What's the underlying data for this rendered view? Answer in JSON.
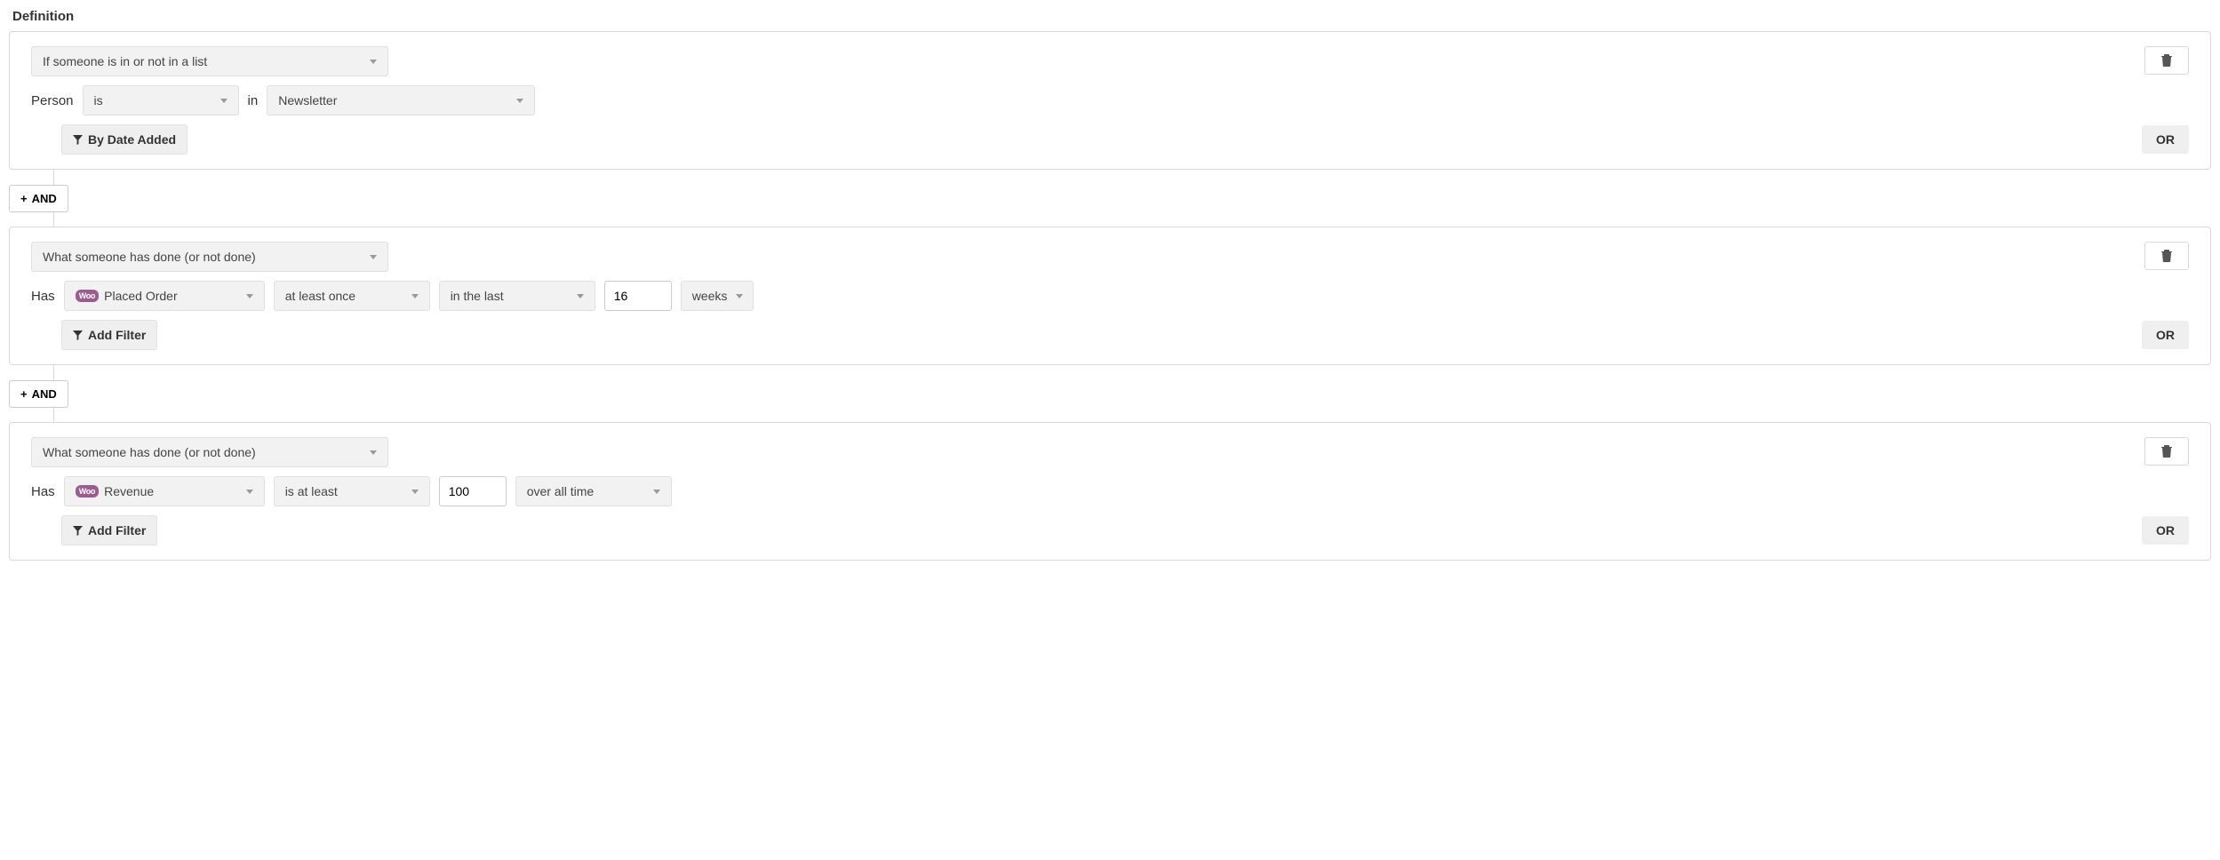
{
  "sectionTitle": "Definition",
  "common": {
    "orLabel": "OR",
    "andLabel": "AND",
    "wooBadge": "Woo"
  },
  "rule1": {
    "condition": "If someone is in or not in a list",
    "personLabel": "Person",
    "personOp": "is",
    "inLabel": "in",
    "listName": "Newsletter",
    "dateAddedBtn": "By Date Added"
  },
  "rule2": {
    "condition": "What someone has done (or not done)",
    "hasLabel": "Has",
    "metric": "Placed Order",
    "frequency": "at least once",
    "timeframe": "in the last",
    "count": "16",
    "unit": "weeks",
    "addFilterBtn": "Add Filter"
  },
  "rule3": {
    "condition": "What someone has done (or not done)",
    "hasLabel": "Has",
    "metric": "Revenue",
    "comparator": "is at least",
    "value": "100",
    "timeframe": "over all time",
    "addFilterBtn": "Add Filter"
  }
}
